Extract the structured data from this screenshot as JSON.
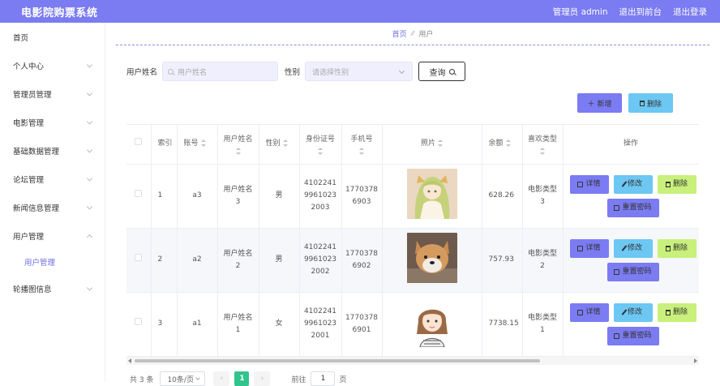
{
  "app": {
    "title": "电影院购票系统",
    "user_label": "管理员 admin",
    "back_to_front": "退出到前台",
    "logout": "退出登录"
  },
  "sidebar": {
    "items": [
      {
        "label": "首页",
        "has_arrow": false
      },
      {
        "label": "个人中心",
        "has_arrow": true
      },
      {
        "label": "管理员管理",
        "has_arrow": true
      },
      {
        "label": "电影管理",
        "has_arrow": true
      },
      {
        "label": "基础数据管理",
        "has_arrow": true
      },
      {
        "label": "论坛管理",
        "has_arrow": true
      },
      {
        "label": "新闻信息管理",
        "has_arrow": true
      },
      {
        "label": "用户管理",
        "has_arrow": true,
        "expanded": true
      },
      {
        "label": "轮播图信息",
        "has_arrow": true
      }
    ],
    "sub_item": "用户管理"
  },
  "breadcrumb": {
    "home": "首页",
    "current": "用户"
  },
  "search": {
    "name_label": "用户姓名",
    "name_placeholder": "用户姓名",
    "gender_label": "性别",
    "gender_placeholder": "请选择性别",
    "query_button": "查询"
  },
  "actions": {
    "add": "新增",
    "delete": "删除"
  },
  "table": {
    "headers": {
      "index": "索引",
      "account": "账号",
      "name": "用户姓名",
      "gender": "性别",
      "id_card": "身份证号",
      "phone": "手机号",
      "photo": "照片",
      "balance": "余额",
      "favorite": "喜欢类型",
      "ops": "操作"
    },
    "rows": [
      {
        "index": "1",
        "account": "a3",
        "name": "用户姓名3",
        "gender": "男",
        "id_card": "410224199610232003",
        "phone": "17703786903",
        "balance": "628.26",
        "favorite": "电影类型3",
        "photo": "anime-girl"
      },
      {
        "index": "2",
        "account": "a2",
        "name": "用户姓名2",
        "gender": "男",
        "id_card": "410224199610232002",
        "phone": "17703786902",
        "balance": "757.93",
        "favorite": "电影类型2",
        "photo": "shiba-dog"
      },
      {
        "index": "3",
        "account": "a1",
        "name": "用户姓名1",
        "gender": "女",
        "id_card": "410224199610232001",
        "phone": "17703786901",
        "balance": "7738.15",
        "favorite": "电影类型1",
        "photo": "cartoon-girl"
      }
    ],
    "op_labels": {
      "detail": "详情",
      "edit": "修改",
      "delete": "删除",
      "reset": "重置密码"
    }
  },
  "pagination": {
    "total": "共 3 条",
    "page_size": "10条/页",
    "current_page": "1",
    "goto_label": "前往",
    "goto_value": "1",
    "page_word": "页"
  },
  "colors": {
    "primary": "#7b7bf2",
    "info": "#6cc7f3",
    "lime": "#c8f07a",
    "pager_active": "#31c48d"
  }
}
